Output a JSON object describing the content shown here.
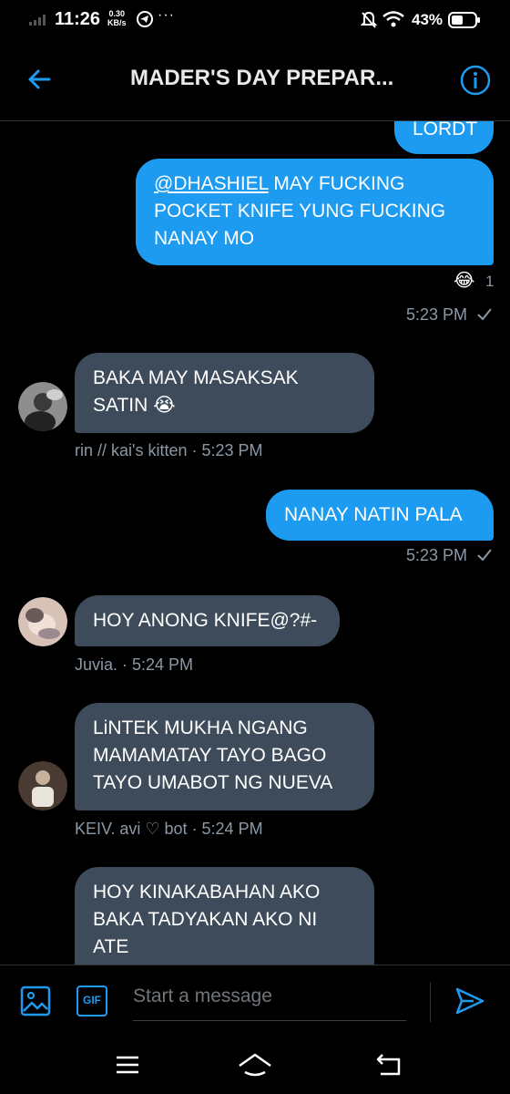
{
  "status_bar": {
    "time": "11:26",
    "speed_value": "0.30",
    "speed_unit": "KB/s",
    "battery": "43%"
  },
  "header": {
    "title": "MADER'S DAY PREPAR...",
    "back_icon": "arrow-left-icon",
    "info_icon": "info-icon"
  },
  "messages": [
    {
      "text": "LORDT"
    },
    {
      "mention": "@DHASHIEL",
      "text": " MAY FUCKING POCKET KNIFE YUNG FUCKING NANAY MO",
      "reaction": "😂",
      "reaction_count": "1",
      "time": "5:23 PM"
    },
    {
      "text": "BAKA MAY MASAKSAK SATIN 😭",
      "meta": "rin // kai's kitten · 5:23 PM"
    },
    {
      "text": "NANAY NATIN PALA",
      "time": "5:23 PM"
    },
    {
      "text": "HOY ANONG KNIFE@?#-",
      "meta": "Juvia. · 5:24 PM"
    },
    {
      "text": "LiNTEK MUKHA NGANG MAMAMATAY TAYO BAGO TAYO UMABOT NG NUEVA",
      "meta": "KEIV. avi ♡ bot · 5:24 PM"
    },
    {
      "text": "HOY KINAKABAHAN AKO BAKA TADYAKAN AKO NI ATE"
    }
  ],
  "composer": {
    "placeholder": "Start a message",
    "gif_label": "GIF"
  },
  "colors": {
    "sent": "#1d9bf0",
    "received": "#3d4b5a",
    "accent": "#1d9bf0",
    "meta": "#8b98a5"
  }
}
